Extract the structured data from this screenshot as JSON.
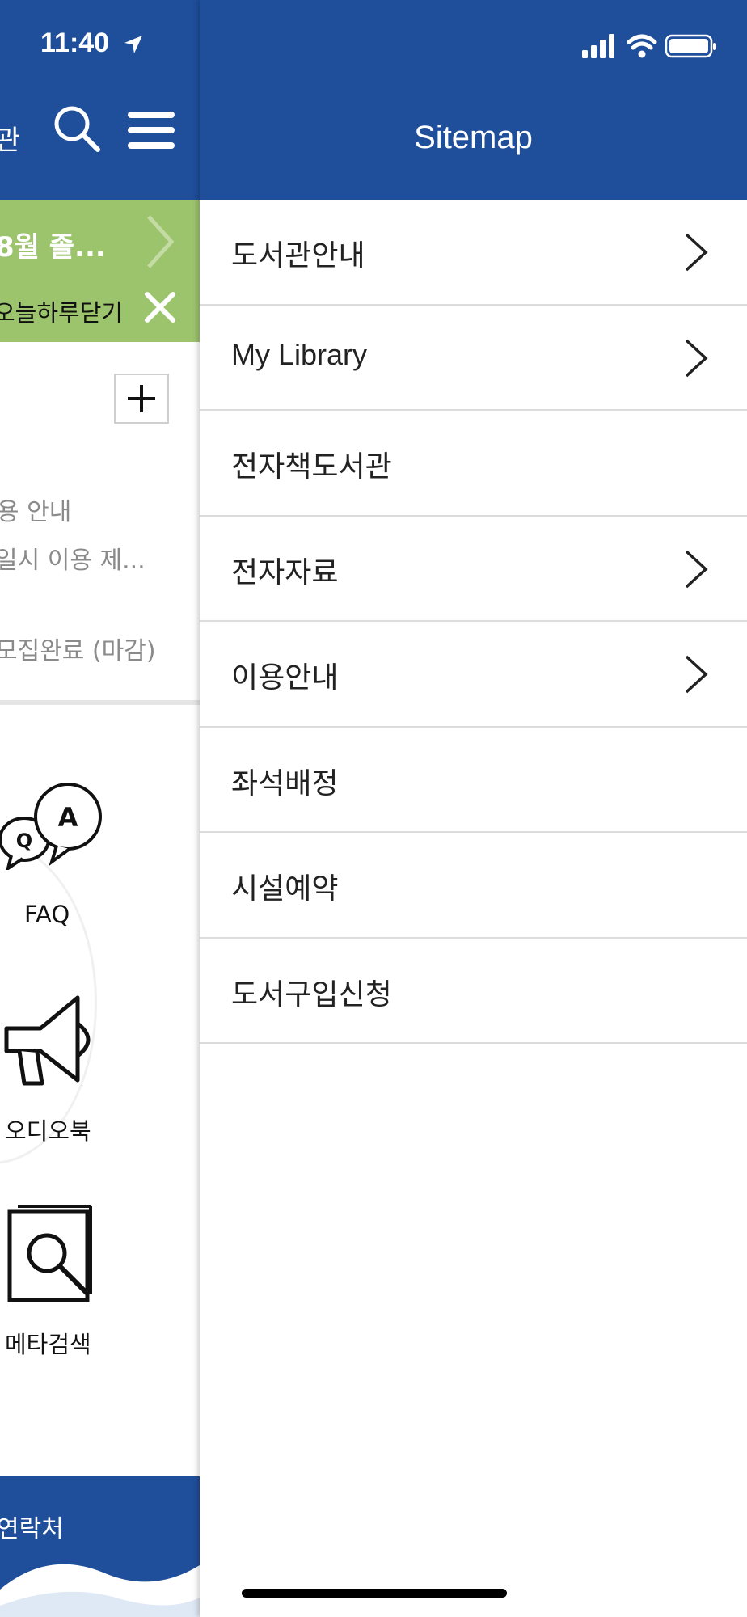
{
  "status_bar": {
    "time": "11:40"
  },
  "background_app": {
    "title_fragment": "관",
    "banner": {
      "title": "8월 졸...",
      "close_today_label": "오늘하루닫기"
    },
    "notices": [
      "용 안내",
      "일시 이용 제...",
      "모집완료 (마감)"
    ],
    "quick_links": [
      {
        "label": "FAQ",
        "icon": "faq-bubbles-icon"
      },
      {
        "label": "오디오북",
        "icon": "megaphone-icon"
      },
      {
        "label": "메타검색",
        "icon": "book-search-icon"
      }
    ],
    "footer_label": "연락처"
  },
  "drawer": {
    "title": "Sitemap",
    "items": [
      {
        "label": "도서관안내",
        "has_submenu": true
      },
      {
        "label": "My Library",
        "has_submenu": true
      },
      {
        "label": "전자책도서관",
        "has_submenu": false
      },
      {
        "label": "전자자료",
        "has_submenu": true
      },
      {
        "label": "이용안내",
        "has_submenu": true
      },
      {
        "label": "좌석배정",
        "has_submenu": false
      },
      {
        "label": "시설예약",
        "has_submenu": false
      },
      {
        "label": "도서구입신청",
        "has_submenu": false
      }
    ]
  },
  "colors": {
    "header_blue": "#1f4e9b",
    "banner_green": "#9cc46c",
    "divider": "#dcdcdc"
  }
}
